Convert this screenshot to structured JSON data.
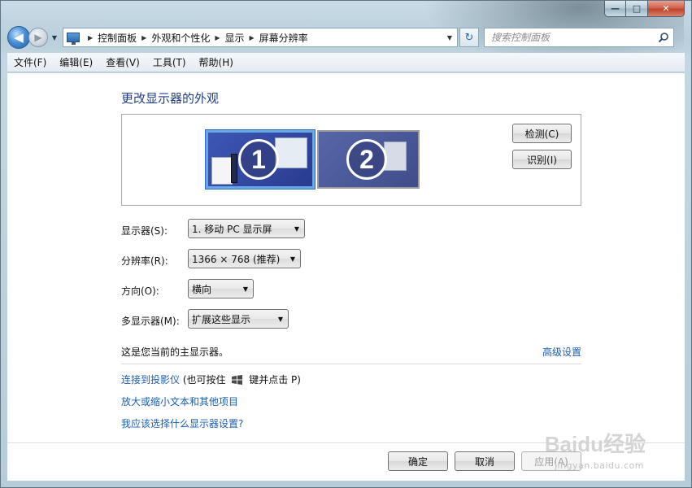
{
  "window": {
    "caption_buttons": {
      "minimize": "—",
      "maximize": "□",
      "close": "✕"
    }
  },
  "nav": {
    "back_icon": "◀",
    "forward_icon": "▶",
    "recent_icon": "▼",
    "breadcrumbs": [
      "控制面板",
      "外观和个性化",
      "显示",
      "屏幕分辨率"
    ],
    "crumb_sep": "▶",
    "address_dropdown": "▼",
    "refresh_icon": "↻",
    "search_placeholder": "搜索控制面板"
  },
  "menu": {
    "items": [
      "文件(F)",
      "编辑(E)",
      "查看(V)",
      "工具(T)",
      "帮助(H)"
    ]
  },
  "main": {
    "heading": "更改显示器的外观",
    "monitors": [
      {
        "number": "1",
        "selected": true
      },
      {
        "number": "2",
        "selected": false
      }
    ],
    "detect_button": "检测(C)",
    "identify_button": "识别(I)",
    "fields": [
      {
        "label": "显示器(S):",
        "value": "1. 移动 PC 显示屏"
      },
      {
        "label": "分辨率(R):",
        "value": "1366 × 768 (推荐)"
      },
      {
        "label": "方向(O):",
        "value": "横向"
      },
      {
        "label": "多显示器(M):",
        "value": "扩展这些显示"
      }
    ],
    "primary_text": "这是您当前的主显示器。",
    "advanced_link": "高级设置",
    "projector_link": "连接到投影仪",
    "projector_hint_pre": "(也可按住",
    "projector_hint_post": "键并点击 P)",
    "zoom_link": "放大或缩小文本和其他项目",
    "help_link": "我应该选择什么显示器设置?"
  },
  "footer": {
    "ok": "确定",
    "cancel": "取消",
    "apply": "应用(A)"
  },
  "watermark": {
    "logo": "Baidu经验",
    "url": "jingyan.baidu.com"
  },
  "colors": {
    "heading": "#1e3f86",
    "link": "#1a5fb4",
    "selected_monitor_border": "#69a8e6"
  }
}
